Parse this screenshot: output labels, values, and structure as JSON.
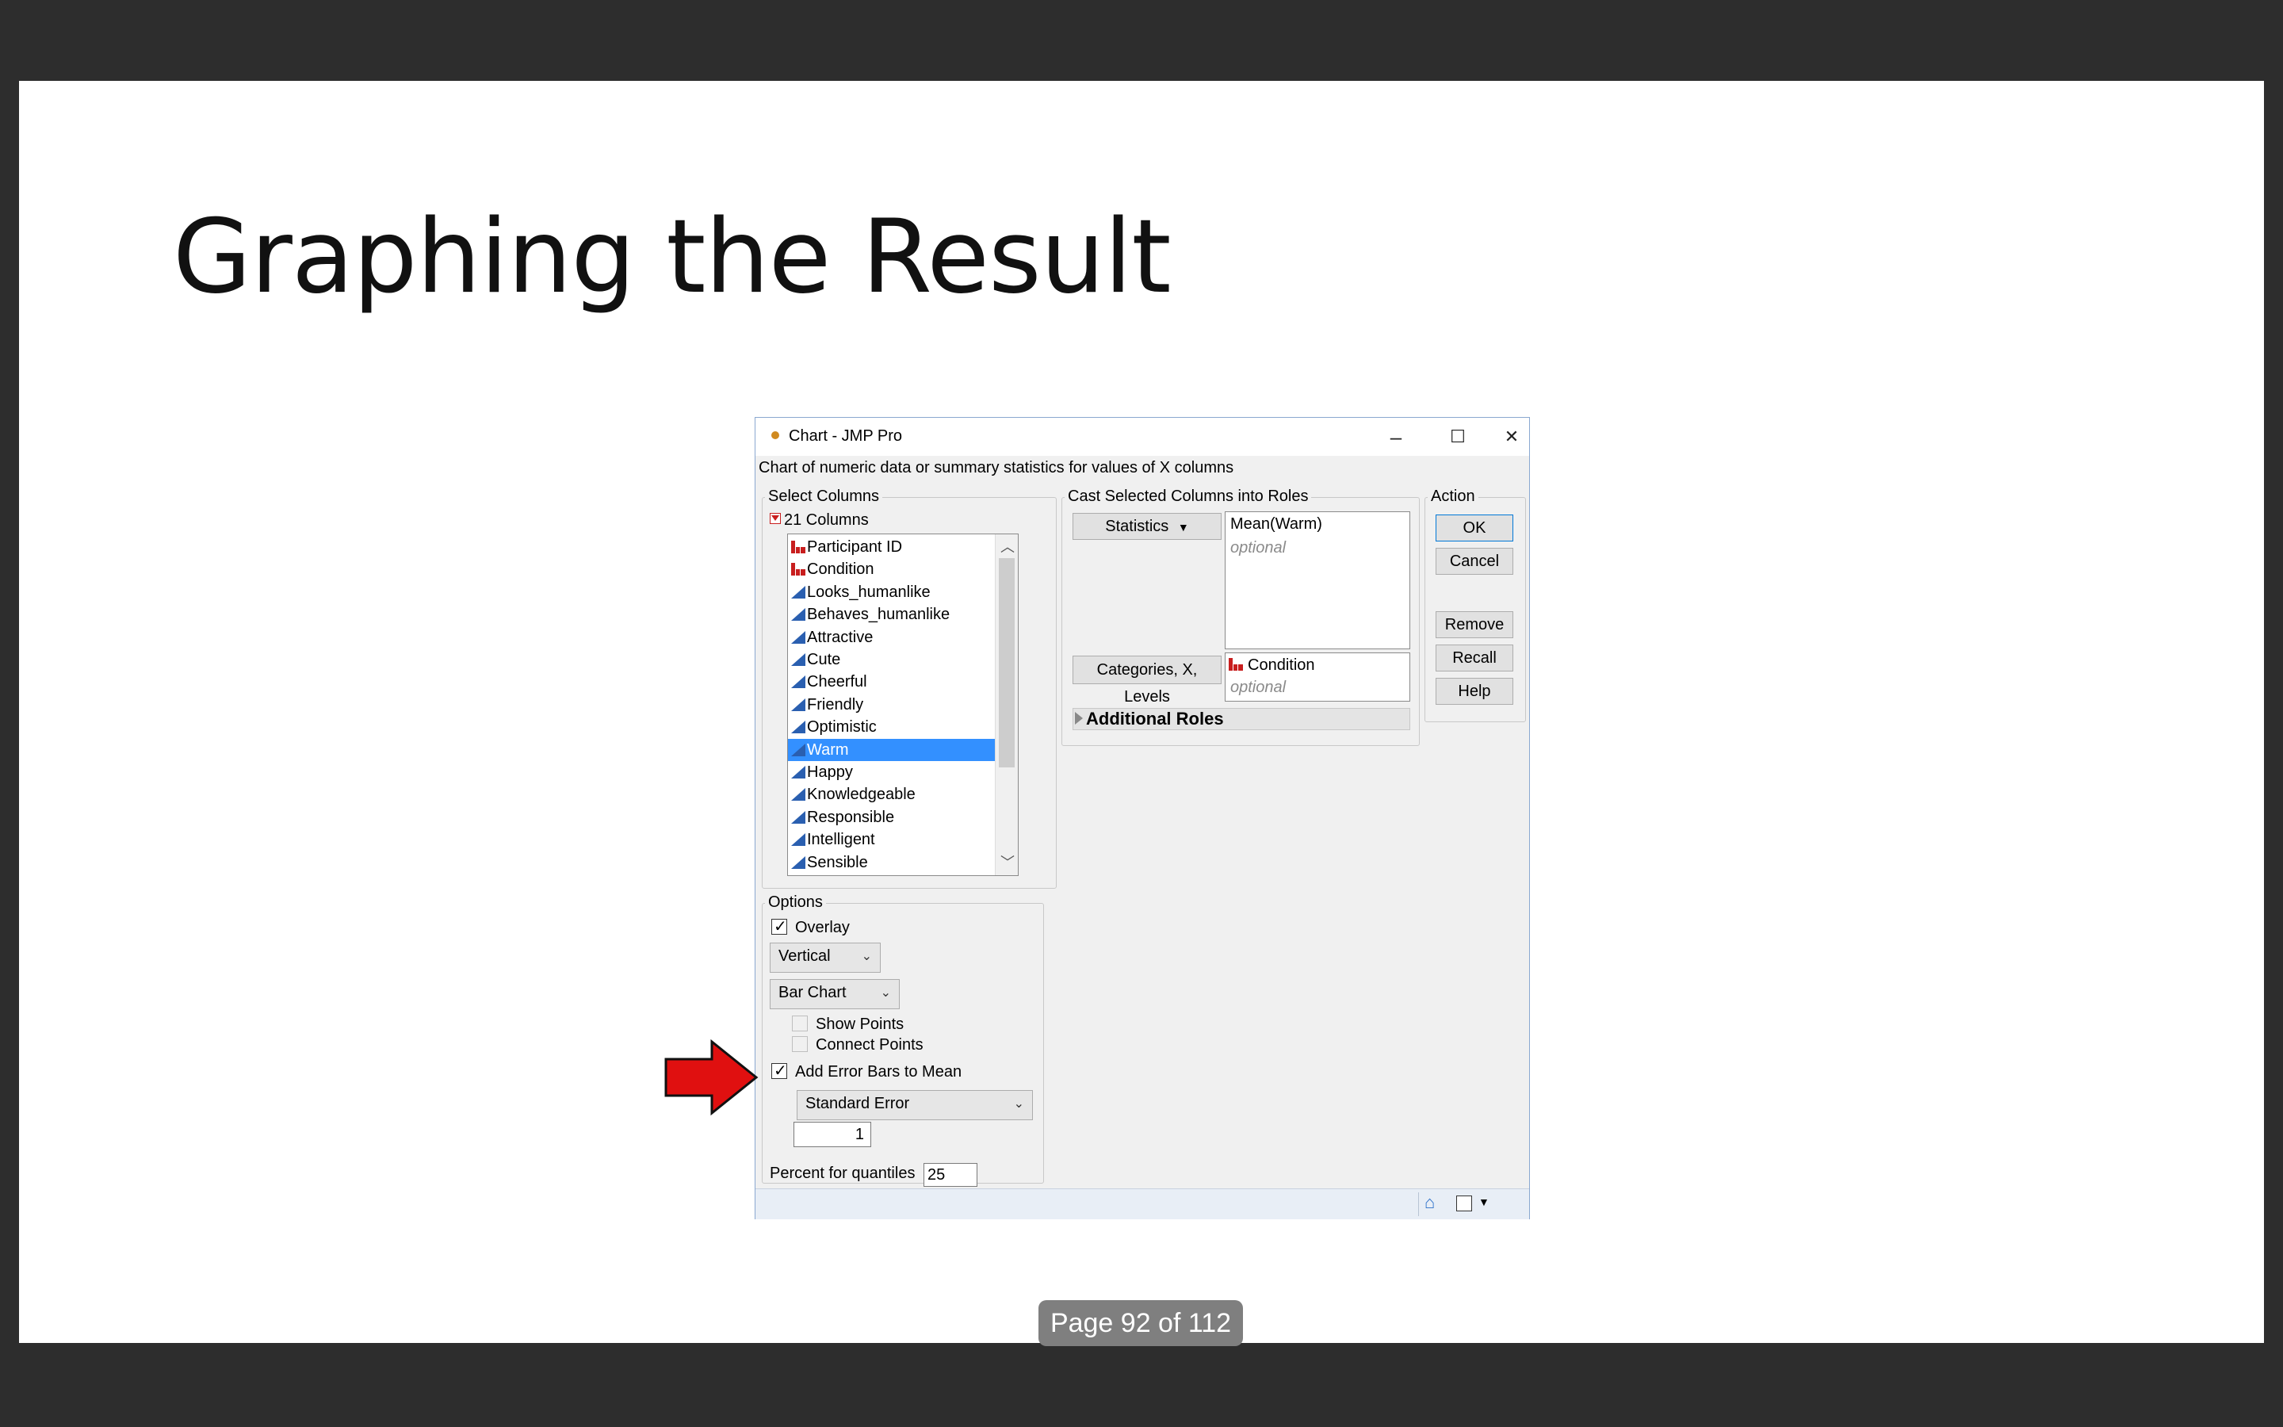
{
  "slide": {
    "title": "Graphing the Result",
    "page_indicator": "Page 92 of 112"
  },
  "dialog": {
    "title": "Chart - JMP Pro",
    "window_controls": {
      "minimize": "–",
      "maximize": "☐",
      "close": "✕"
    },
    "description": "Chart of numeric data or summary statistics for values of X columns",
    "select_columns": {
      "label": "Select Columns",
      "count_label": "21 Columns",
      "columns": [
        {
          "name": "Participant ID",
          "type": "nominal"
        },
        {
          "name": "Condition",
          "type": "nominal"
        },
        {
          "name": "Looks_humanlike",
          "type": "continuous"
        },
        {
          "name": "Behaves_humanlike",
          "type": "continuous"
        },
        {
          "name": "Attractive",
          "type": "continuous"
        },
        {
          "name": "Cute",
          "type": "continuous"
        },
        {
          "name": "Cheerful",
          "type": "continuous"
        },
        {
          "name": "Friendly",
          "type": "continuous"
        },
        {
          "name": "Optimistic",
          "type": "continuous"
        },
        {
          "name": "Warm",
          "type": "continuous",
          "selected": true
        },
        {
          "name": "Happy",
          "type": "continuous"
        },
        {
          "name": "Knowledgeable",
          "type": "continuous"
        },
        {
          "name": "Responsible",
          "type": "continuous"
        },
        {
          "name": "Intelligent",
          "type": "continuous"
        },
        {
          "name": "Sensible",
          "type": "continuous"
        }
      ]
    },
    "cast": {
      "label": "Cast Selected Columns into Roles",
      "statistics_button": "Statistics",
      "statistics_value": "Mean(Warm)",
      "statistics_placeholder": "optional",
      "categories_button": "Categories, X, Levels",
      "categories_value": "Condition",
      "categories_placeholder": "optional",
      "additional_roles": "Additional Roles"
    },
    "action": {
      "label": "Action",
      "ok": "OK",
      "cancel": "Cancel",
      "remove": "Remove",
      "recall": "Recall",
      "help": "Help"
    },
    "options": {
      "label": "Options",
      "overlay_label": "Overlay",
      "overlay_checked": true,
      "orientation": "Vertical",
      "chart_type": "Bar Chart",
      "show_points_label": "Show Points",
      "show_points_checked": false,
      "connect_points_label": "Connect Points",
      "connect_points_checked": false,
      "error_bars_label": "Add Error Bars to Mean",
      "error_bars_checked": true,
      "error_type": "Standard Error",
      "error_multiplier": "1",
      "quantiles_label": "Percent for quantiles",
      "quantiles_value": "25"
    }
  },
  "colors": {
    "selection": "#3390ff",
    "arrow": "#e01010",
    "nominal_icon": "#c81e1e",
    "continuous_icon": "#2a5fb0"
  }
}
